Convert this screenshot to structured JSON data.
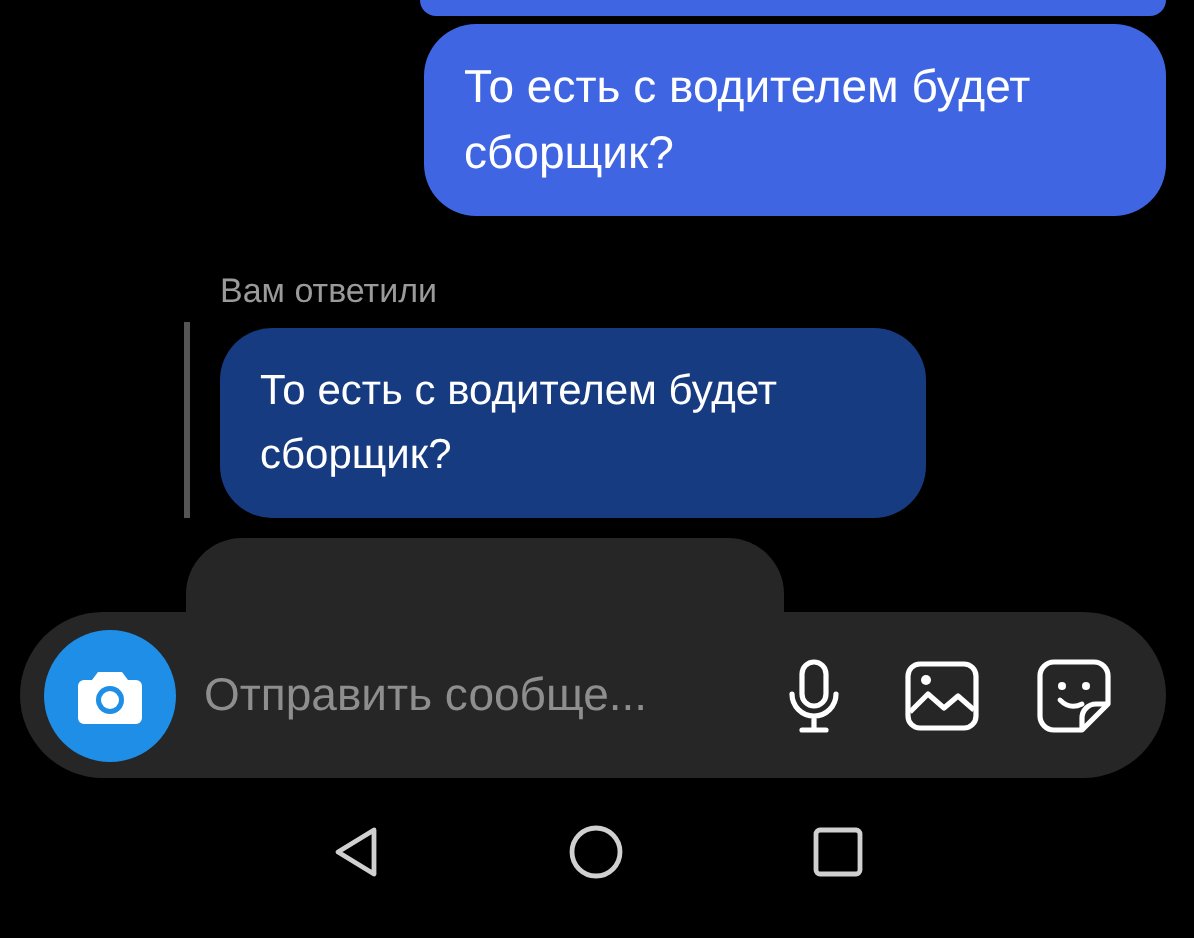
{
  "messages": [
    {
      "kind": "outgoing_partial"
    },
    {
      "kind": "outgoing",
      "text": "То есть с водителем будет сборщик?"
    },
    {
      "kind": "reply_label",
      "text": "Вам ответили"
    },
    {
      "kind": "quoted",
      "text": "То есть с водителем будет сборщик?"
    },
    {
      "kind": "incoming_partial"
    }
  ],
  "composer": {
    "placeholder": "Отправить сообще..."
  },
  "nav_bar": {
    "buttons": [
      {
        "kind": "back"
      },
      {
        "kind": "home"
      },
      {
        "kind": "recents"
      }
    ]
  }
}
